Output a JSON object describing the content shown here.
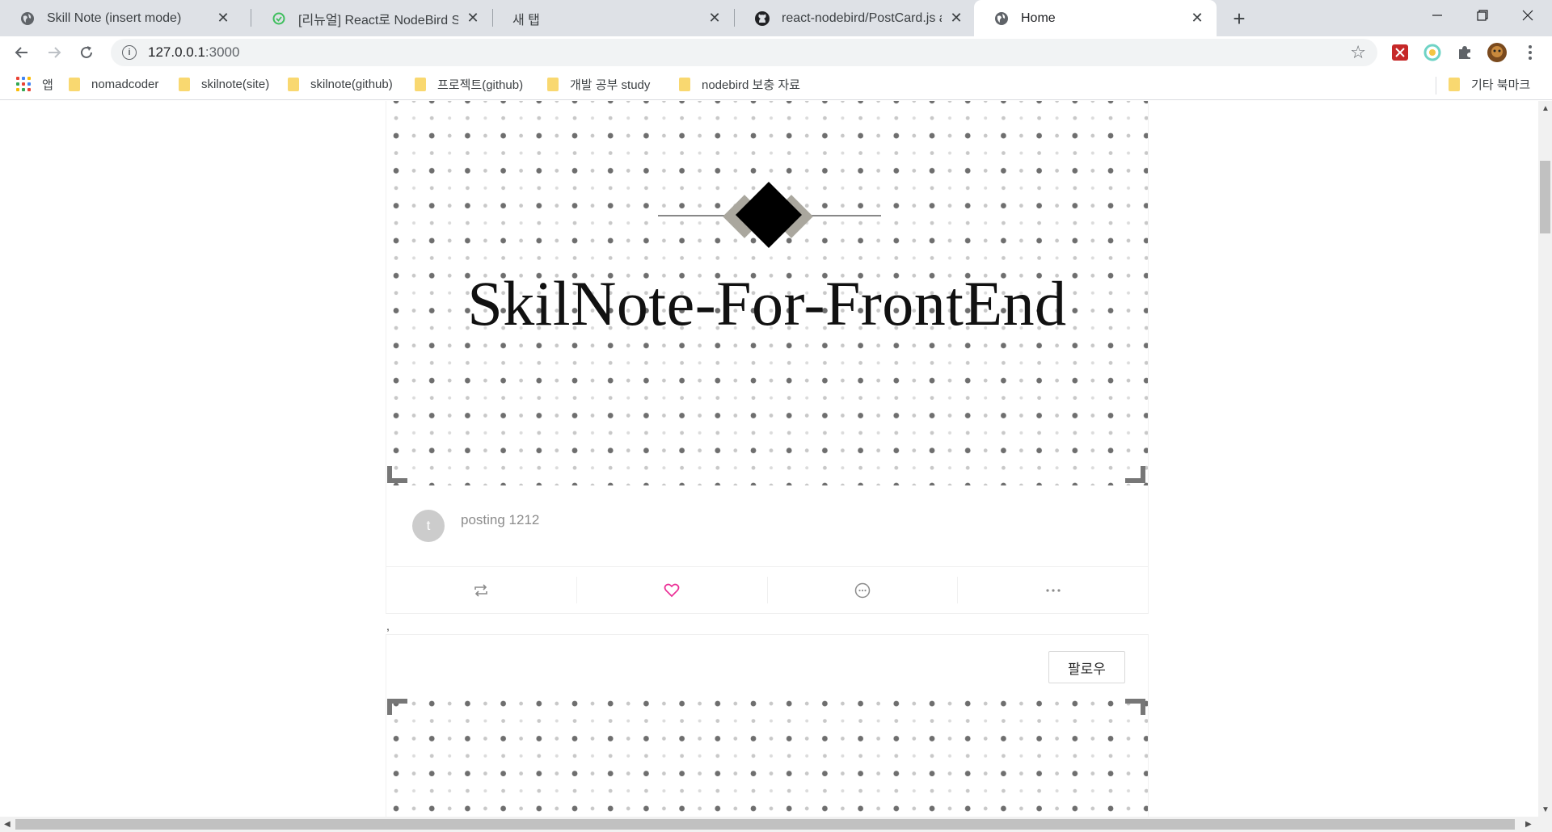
{
  "tabs": [
    {
      "title": "Skill Note (insert mode)",
      "icon": "globe-icon",
      "active": false
    },
    {
      "title": "[리뉴얼] React로 NodeBird SNS",
      "icon": "inflearn-icon",
      "active": false
    },
    {
      "title": "새 탭",
      "icon": "none",
      "active": false
    },
    {
      "title": "react-nodebird/PostCard.js at re",
      "icon": "github-icon",
      "active": false
    },
    {
      "title": "Home",
      "icon": "globe-icon",
      "active": true
    }
  ],
  "address": {
    "host": "127.0.0.1",
    "port": ":3000"
  },
  "bookmarks": {
    "apps_label": "앱",
    "items": [
      "nomadcoder",
      "skilnote(site)",
      "skilnote(github)",
      "프로젝트(github)",
      "개발 공부 study",
      "nodebird 보충 자료"
    ],
    "other_label": "기타 북마크"
  },
  "post": {
    "cover_title": "SkilNote-For-FrontEnd",
    "avatar_letter": "t",
    "content": "posting 1212",
    "comma": ",",
    "follow_label": "팔로우",
    "like_color": "#eb2f96"
  },
  "colors": {
    "tabstrip": "#dee1e6",
    "folder": "#f9d870",
    "accent": "#eb2f96"
  }
}
